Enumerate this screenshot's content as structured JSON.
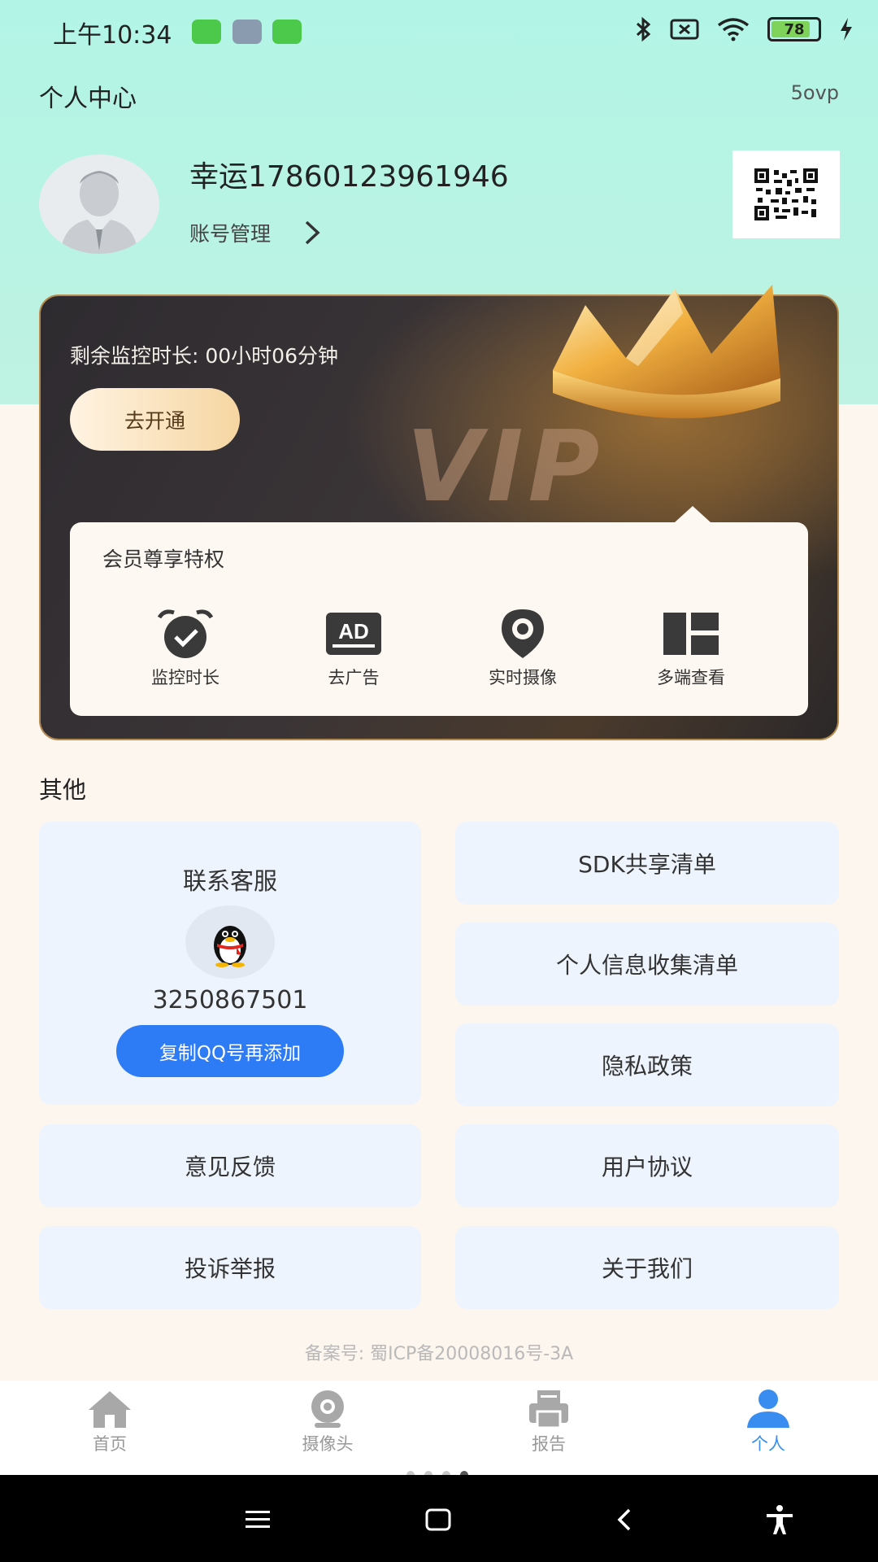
{
  "status_bar": {
    "time": "上午10:34",
    "battery": "78"
  },
  "header": {
    "title": "个人中心",
    "right_text": "5ovp"
  },
  "profile": {
    "username": "幸运17860123961946",
    "account_manage": "账号管理"
  },
  "vip": {
    "remaining_label": "剩余监控时长: 00小时06分钟",
    "open_button": "去开通",
    "watermark": "VIP",
    "privileges_title": "会员尊享特权",
    "privileges": [
      {
        "label": "监控时长",
        "icon": "alarm-check-icon"
      },
      {
        "label": "去广告",
        "icon": "ad-icon"
      },
      {
        "label": "实时摄像",
        "icon": "location-pin-icon"
      },
      {
        "label": "多端查看",
        "icon": "multi-grid-icon"
      }
    ]
  },
  "other": {
    "section_title": "其他",
    "service": {
      "title": "联系客服",
      "qq_number": "3250867501",
      "copy_button": "复制QQ号再添加"
    },
    "links": {
      "sdk": "SDK共享清单",
      "personal_info": "个人信息收集清单",
      "privacy": "隐私政策",
      "feedback": "意见反馈",
      "agreement": "用户协议",
      "complaint": "投诉举报",
      "about": "关于我们"
    }
  },
  "footer": {
    "icp": "备案号: 蜀ICP备20008016号-3A"
  },
  "tabbar": {
    "home": "首页",
    "camera": "摄像头",
    "report": "报告",
    "profile": "个人",
    "active": "profile",
    "active_color": "#3a8df0"
  },
  "colors": {
    "accent": "#2e7bf6",
    "tile_bg": "#eef4fd",
    "header_bg": "#b2f5e6"
  }
}
